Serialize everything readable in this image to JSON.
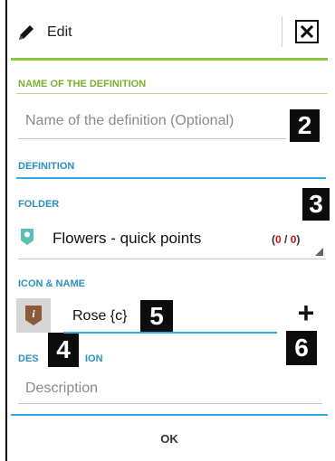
{
  "header": {
    "title": "Edit"
  },
  "name_section": {
    "label": "NAME OF THE DEFINITION",
    "placeholder": "Name of the definition (Optional)",
    "badge": "2"
  },
  "definition_section": {
    "label": "DEFINITION"
  },
  "folder_section": {
    "label": "FOLDER",
    "badge": "3",
    "value": "Flowers - quick points",
    "count_open": "(",
    "count_current": "0",
    "count_sep": " / ",
    "count_total": "0",
    "count_close": ")"
  },
  "icon_name_section": {
    "label": "ICON & NAME",
    "value": "Rose {c}",
    "badge_name": "5",
    "badge_icon": "4",
    "badge_add": "6",
    "add_symbol": "+"
  },
  "description_section": {
    "label_start": "DES",
    "label_end": "ION",
    "placeholder": "Description"
  },
  "footer": {
    "ok_label": "OK"
  },
  "colors": {
    "accent_green": "#8dc63f",
    "accent_blue": "#33a9dd",
    "count_red": "#d0121a",
    "badge_bg": "#0c0c0c"
  },
  "icons": {
    "header": "pencil-icon",
    "close": "close-icon",
    "folder": "folder-marker-icon",
    "entry": "info-marker-icon",
    "add": "plus-icon",
    "dropdown": "dropdown-corner-icon"
  }
}
